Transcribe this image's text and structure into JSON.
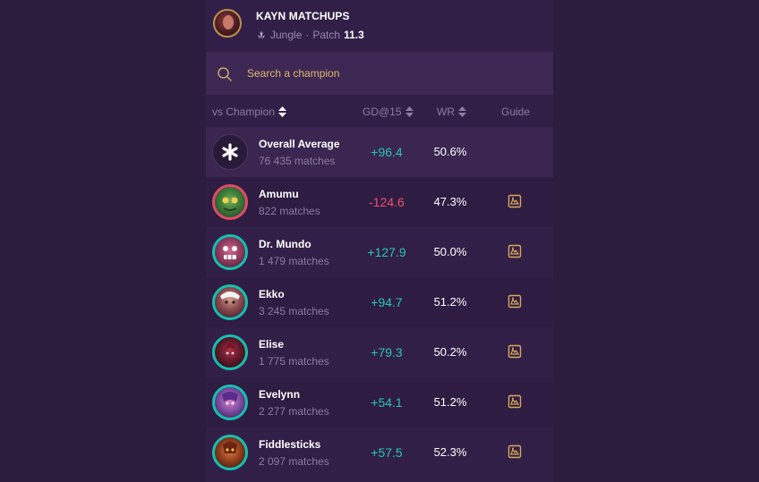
{
  "header": {
    "title": "KAYN MATCHUPS",
    "role": "Jungle",
    "separator": "·",
    "patch_label": "Patch",
    "patch_value": "11.3",
    "avatar_icon": "kayn-portrait",
    "role_icon": "jungle-role-icon"
  },
  "search": {
    "placeholder": "Search a champion",
    "value": ""
  },
  "columns": {
    "champion": "vs Champion",
    "gd": "GD@15",
    "wr": "WR",
    "guide": "Guide"
  },
  "colors": {
    "positive": "#25c7b0",
    "negative": "#f0506e",
    "accent": "#e0b66b",
    "background": "#2c1c3d"
  },
  "rows": [
    {
      "name": "Overall Average",
      "matches": "76 435 matches",
      "gd": "+96.4",
      "wr": "50.6%",
      "icon": "asterisk-icon",
      "guide": false
    },
    {
      "name": "Amumu",
      "matches": "822 matches",
      "gd": "-124.6",
      "wr": "47.3%",
      "icon": "amumu-portrait",
      "guide": true
    },
    {
      "name": "Dr. Mundo",
      "matches": "1 479 matches",
      "gd": "+127.9",
      "wr": "50.0%",
      "icon": "drmundo-portrait",
      "guide": true
    },
    {
      "name": "Ekko",
      "matches": "3 245 matches",
      "gd": "+94.7",
      "wr": "51.2%",
      "icon": "ekko-portrait",
      "guide": true
    },
    {
      "name": "Elise",
      "matches": "1 775 matches",
      "gd": "+79.3",
      "wr": "50.2%",
      "icon": "elise-portrait",
      "guide": true
    },
    {
      "name": "Evelynn",
      "matches": "2 277 matches",
      "gd": "+54.1",
      "wr": "51.2%",
      "icon": "evelynn-portrait",
      "guide": true
    },
    {
      "name": "Fiddlesticks",
      "matches": "2 097 matches",
      "gd": "+57.5",
      "wr": "52.3%",
      "icon": "fiddlesticks-portrait",
      "guide": true
    }
  ]
}
